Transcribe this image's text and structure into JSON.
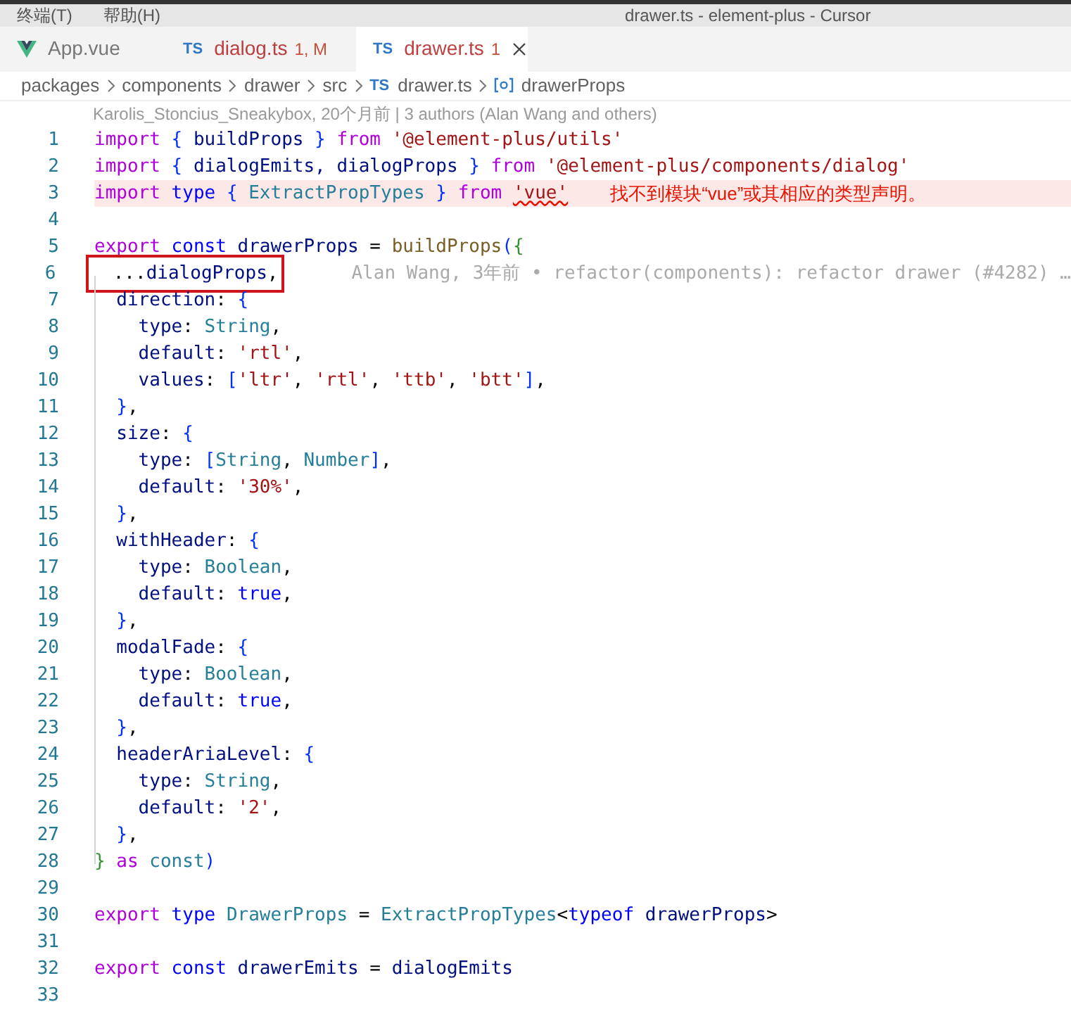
{
  "menu_bar": {
    "items": [
      "终端(T)",
      "帮助(H)"
    ],
    "title": "drawer.ts - element-plus - Cursor"
  },
  "tabs": [
    {
      "kind": "vue",
      "label": "App.vue",
      "error": false,
      "selected": false
    },
    {
      "kind": "ts",
      "icon_label": "TS",
      "label": "dialog.ts",
      "badge": "1, M",
      "error": true,
      "selected": false
    },
    {
      "kind": "ts",
      "icon_label": "TS",
      "label": "drawer.ts",
      "badge": "1",
      "error": true,
      "selected": true
    }
  ],
  "breadcrumb": [
    {
      "kind": "folder",
      "text": "packages"
    },
    {
      "kind": "folder",
      "text": "components"
    },
    {
      "kind": "folder",
      "text": "drawer"
    },
    {
      "kind": "folder",
      "text": "src"
    },
    {
      "kind": "ts",
      "icon_label": "TS",
      "text": "drawer.ts"
    },
    {
      "kind": "symbol",
      "text": "drawerProps"
    }
  ],
  "blame_header": "Karolis_Stoncius_Sneakybox, 20个月前 | 3 authors (Alan Wang and others)",
  "lines": [
    {
      "number": "1",
      "tokens": [
        {
          "kind": "kw",
          "text": "import "
        },
        {
          "kind": "br",
          "text": "{"
        },
        {
          "kind": "id",
          "text": " buildProps "
        },
        {
          "kind": "br",
          "text": "} "
        },
        {
          "kind": "kw",
          "text": "from "
        },
        {
          "kind": "str",
          "text": "'@element-plus/utils'"
        }
      ]
    },
    {
      "number": "2",
      "tokens": [
        {
          "kind": "kw",
          "text": "import "
        },
        {
          "kind": "br",
          "text": "{"
        },
        {
          "kind": "id",
          "text": " dialogEmits, dialogProps "
        },
        {
          "kind": "br",
          "text": "} "
        },
        {
          "kind": "kw",
          "text": "from "
        },
        {
          "kind": "str",
          "text": "'@element-plus/components/dialog'"
        }
      ]
    },
    {
      "number": "3",
      "error": "找不到模块“vue”或其相应的类型声明。",
      "tokens": [
        {
          "kind": "kw",
          "text": "import "
        },
        {
          "kind": "st",
          "text": "type "
        },
        {
          "kind": "br",
          "text": "{"
        },
        {
          "kind": "ty",
          "text": " ExtractPropTypes "
        },
        {
          "kind": "br",
          "text": "} "
        },
        {
          "kind": "kw",
          "text": "from "
        },
        {
          "kind": "err",
          "text": "'vue'"
        }
      ]
    },
    {
      "number": "4"
    },
    {
      "number": "5",
      "tokens": [
        {
          "kind": "kw",
          "text": "export "
        },
        {
          "kind": "st",
          "text": "const "
        },
        {
          "kind": "id",
          "text": "drawerProps"
        },
        {
          "kind": "p",
          "text": " = "
        },
        {
          "kind": "fn",
          "text": "buildProps"
        },
        {
          "kind": "br",
          "text": "("
        },
        {
          "kind": "br2",
          "text": "{"
        }
      ]
    },
    {
      "number": "6",
      "boxed": true,
      "blame": "Alan Wang, 3年前 • refactor(components): refactor drawer (#4282) …",
      "tokens": [
        {
          "kind": "p",
          "text": "  ..."
        },
        {
          "kind": "id",
          "text": "dialogProps"
        },
        {
          "kind": "p",
          "text": ","
        }
      ]
    },
    {
      "number": "7",
      "tokens": [
        {
          "kind": "id",
          "text": "  direction"
        },
        {
          "kind": "p",
          "text": ": "
        },
        {
          "kind": "br",
          "text": "{"
        }
      ]
    },
    {
      "number": "8",
      "tokens": [
        {
          "kind": "id",
          "text": "    type"
        },
        {
          "kind": "p",
          "text": ": "
        },
        {
          "kind": "ty",
          "text": "String"
        },
        {
          "kind": "p",
          "text": ","
        }
      ]
    },
    {
      "number": "9",
      "tokens": [
        {
          "kind": "id",
          "text": "    default"
        },
        {
          "kind": "p",
          "text": ": "
        },
        {
          "kind": "str",
          "text": "'rtl'"
        },
        {
          "kind": "p",
          "text": ","
        }
      ]
    },
    {
      "number": "10",
      "tokens": [
        {
          "kind": "id",
          "text": "    values"
        },
        {
          "kind": "p",
          "text": ": "
        },
        {
          "kind": "br",
          "text": "["
        },
        {
          "kind": "str",
          "text": "'ltr'"
        },
        {
          "kind": "p",
          "text": ", "
        },
        {
          "kind": "str",
          "text": "'rtl'"
        },
        {
          "kind": "p",
          "text": ", "
        },
        {
          "kind": "str",
          "text": "'ttb'"
        },
        {
          "kind": "p",
          "text": ", "
        },
        {
          "kind": "str",
          "text": "'btt'"
        },
        {
          "kind": "br",
          "text": "]"
        },
        {
          "kind": "p",
          "text": ","
        }
      ]
    },
    {
      "number": "11",
      "tokens": [
        {
          "kind": "br",
          "text": "  }"
        },
        {
          "kind": "p",
          "text": ","
        }
      ]
    },
    {
      "number": "12",
      "tokens": [
        {
          "kind": "id",
          "text": "  size"
        },
        {
          "kind": "p",
          "text": ": "
        },
        {
          "kind": "br",
          "text": "{"
        }
      ]
    },
    {
      "number": "13",
      "tokens": [
        {
          "kind": "id",
          "text": "    type"
        },
        {
          "kind": "p",
          "text": ": "
        },
        {
          "kind": "br",
          "text": "["
        },
        {
          "kind": "ty",
          "text": "String"
        },
        {
          "kind": "p",
          "text": ", "
        },
        {
          "kind": "ty",
          "text": "Number"
        },
        {
          "kind": "br",
          "text": "]"
        },
        {
          "kind": "p",
          "text": ","
        }
      ]
    },
    {
      "number": "14",
      "tokens": [
        {
          "kind": "id",
          "text": "    default"
        },
        {
          "kind": "p",
          "text": ": "
        },
        {
          "kind": "str",
          "text": "'30%'"
        },
        {
          "kind": "p",
          "text": ","
        }
      ]
    },
    {
      "number": "15",
      "tokens": [
        {
          "kind": "br",
          "text": "  }"
        },
        {
          "kind": "p",
          "text": ","
        }
      ]
    },
    {
      "number": "16",
      "tokens": [
        {
          "kind": "id",
          "text": "  withHeader"
        },
        {
          "kind": "p",
          "text": ": "
        },
        {
          "kind": "br",
          "text": "{"
        }
      ]
    },
    {
      "number": "17",
      "tokens": [
        {
          "kind": "id",
          "text": "    type"
        },
        {
          "kind": "p",
          "text": ": "
        },
        {
          "kind": "ty",
          "text": "Boolean"
        },
        {
          "kind": "p",
          "text": ","
        }
      ]
    },
    {
      "number": "18",
      "tokens": [
        {
          "kind": "id",
          "text": "    default"
        },
        {
          "kind": "p",
          "text": ": "
        },
        {
          "kind": "st",
          "text": "true"
        },
        {
          "kind": "p",
          "text": ","
        }
      ]
    },
    {
      "number": "19",
      "tokens": [
        {
          "kind": "br",
          "text": "  }"
        },
        {
          "kind": "p",
          "text": ","
        }
      ]
    },
    {
      "number": "20",
      "tokens": [
        {
          "kind": "id",
          "text": "  modalFade"
        },
        {
          "kind": "p",
          "text": ": "
        },
        {
          "kind": "br",
          "text": "{"
        }
      ]
    },
    {
      "number": "21",
      "tokens": [
        {
          "kind": "id",
          "text": "    type"
        },
        {
          "kind": "p",
          "text": ": "
        },
        {
          "kind": "ty",
          "text": "Boolean"
        },
        {
          "kind": "p",
          "text": ","
        }
      ]
    },
    {
      "number": "22",
      "tokens": [
        {
          "kind": "id",
          "text": "    default"
        },
        {
          "kind": "p",
          "text": ": "
        },
        {
          "kind": "st",
          "text": "true"
        },
        {
          "kind": "p",
          "text": ","
        }
      ]
    },
    {
      "number": "23",
      "tokens": [
        {
          "kind": "br",
          "text": "  }"
        },
        {
          "kind": "p",
          "text": ","
        }
      ]
    },
    {
      "number": "24",
      "tokens": [
        {
          "kind": "id",
          "text": "  headerAriaLevel"
        },
        {
          "kind": "p",
          "text": ": "
        },
        {
          "kind": "br",
          "text": "{"
        }
      ]
    },
    {
      "number": "25",
      "tokens": [
        {
          "kind": "id",
          "text": "    type"
        },
        {
          "kind": "p",
          "text": ": "
        },
        {
          "kind": "ty",
          "text": "String"
        },
        {
          "kind": "p",
          "text": ","
        }
      ]
    },
    {
      "number": "26",
      "tokens": [
        {
          "kind": "id",
          "text": "    default"
        },
        {
          "kind": "p",
          "text": ": "
        },
        {
          "kind": "str",
          "text": "'2'"
        },
        {
          "kind": "p",
          "text": ","
        }
      ]
    },
    {
      "number": "27",
      "tokens": [
        {
          "kind": "br",
          "text": "  }"
        },
        {
          "kind": "p",
          "text": ","
        }
      ]
    },
    {
      "number": "28",
      "tokens": [
        {
          "kind": "br2",
          "text": "} "
        },
        {
          "kind": "kw",
          "text": "as "
        },
        {
          "kind": "ty",
          "text": "const"
        },
        {
          "kind": "br",
          "text": ")"
        }
      ]
    },
    {
      "number": "29"
    },
    {
      "number": "30",
      "tokens": [
        {
          "kind": "kw",
          "text": "export "
        },
        {
          "kind": "st",
          "text": "type "
        },
        {
          "kind": "ty",
          "text": "DrawerProps"
        },
        {
          "kind": "p",
          "text": " = "
        },
        {
          "kind": "ty",
          "text": "ExtractPropTypes"
        },
        {
          "kind": "p",
          "text": "<"
        },
        {
          "kind": "st",
          "text": "typeof "
        },
        {
          "kind": "id",
          "text": "drawerProps"
        },
        {
          "kind": "p",
          "text": ">"
        }
      ]
    },
    {
      "number": "31"
    },
    {
      "number": "32",
      "tokens": [
        {
          "kind": "kw",
          "text": "export "
        },
        {
          "kind": "st",
          "text": "const "
        },
        {
          "kind": "id",
          "text": "drawerEmits"
        },
        {
          "kind": "p",
          "text": " = "
        },
        {
          "kind": "id",
          "text": "dialogEmits"
        }
      ]
    },
    {
      "number": "33"
    }
  ]
}
